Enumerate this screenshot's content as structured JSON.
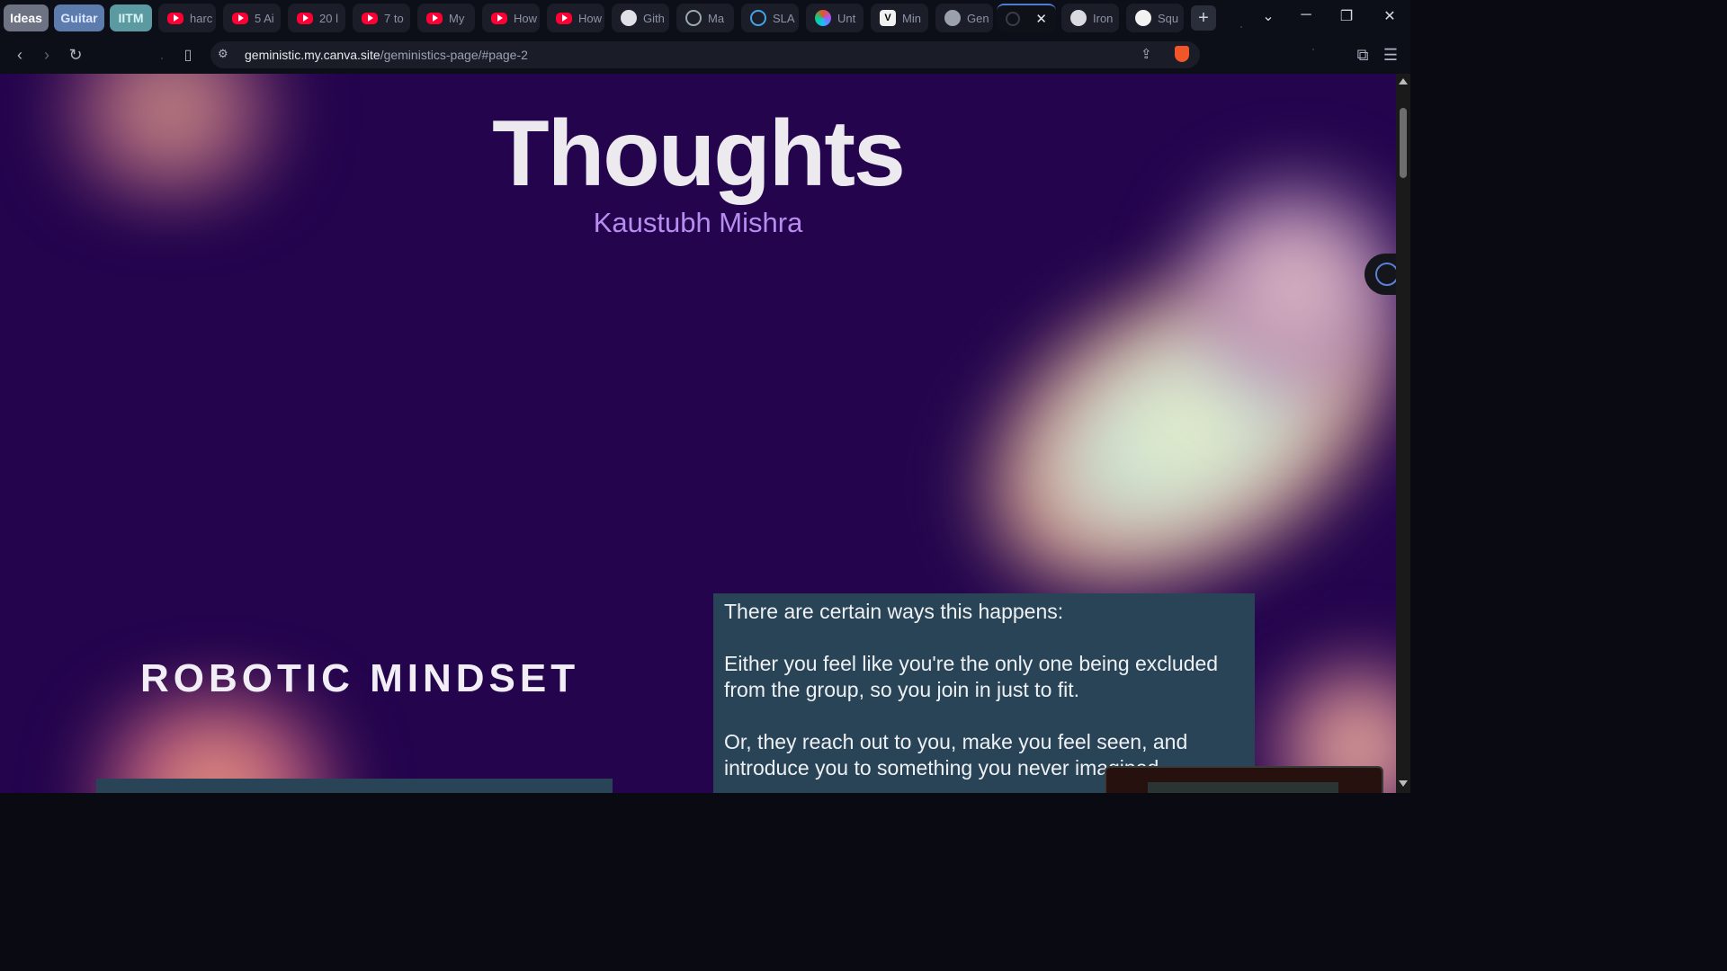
{
  "tab_groups": [
    {
      "label": "Ideas",
      "color": "#6e7383",
      "text": "#ffffff"
    },
    {
      "label": "Guitar",
      "color": "#5c7cae",
      "text": "#dbe6ff"
    },
    {
      "label": "IITM",
      "color": "#5c9aa2",
      "text": "#d7f4f6"
    }
  ],
  "tabs": [
    {
      "title": "harc",
      "icon": "youtube-icon"
    },
    {
      "title": "5 Ai",
      "icon": "youtube-icon"
    },
    {
      "title": "20 l",
      "icon": "youtube-icon"
    },
    {
      "title": "7 to",
      "icon": "youtube-icon"
    },
    {
      "title": "My",
      "icon": "youtube-icon"
    },
    {
      "title": "How",
      "icon": "youtube-icon"
    },
    {
      "title": "How",
      "icon": "youtube-icon"
    },
    {
      "title": "Gith",
      "icon": "github-icon"
    },
    {
      "title": "Ma",
      "icon": "mask-icon"
    },
    {
      "title": "SLA",
      "icon": "circle-icon"
    },
    {
      "title": "Unt",
      "icon": "figma-icon"
    },
    {
      "title": "Min",
      "icon": "vercel-icon"
    },
    {
      "title": "Gen",
      "icon": "globe-icon"
    },
    {
      "title": "",
      "icon": "loading-icon",
      "active": true
    },
    {
      "title": "Iron",
      "icon": "openai-icon"
    },
    {
      "title": "Squ",
      "icon": "search-icon"
    }
  ],
  "address_bar": {
    "host": "geministic.my.canva.site",
    "path": "/geministics-page/#page-2"
  },
  "page": {
    "title": "Thoughts",
    "author": "Kaustubh Mishra",
    "section_heading": "ROBOTIC MINDSET",
    "paragraphs": [
      "There are certain ways this happens:",
      "Either you feel like you're the only one being excluded from the group, so you join in just to fit.",
      "Or, they reach out to you, make you feel seen, and introduce you to something you never imagined."
    ]
  },
  "colors": {
    "page_background": "#23044d",
    "title": "#ece9ef",
    "author": "#b98cf0",
    "textbox": "#294357"
  }
}
